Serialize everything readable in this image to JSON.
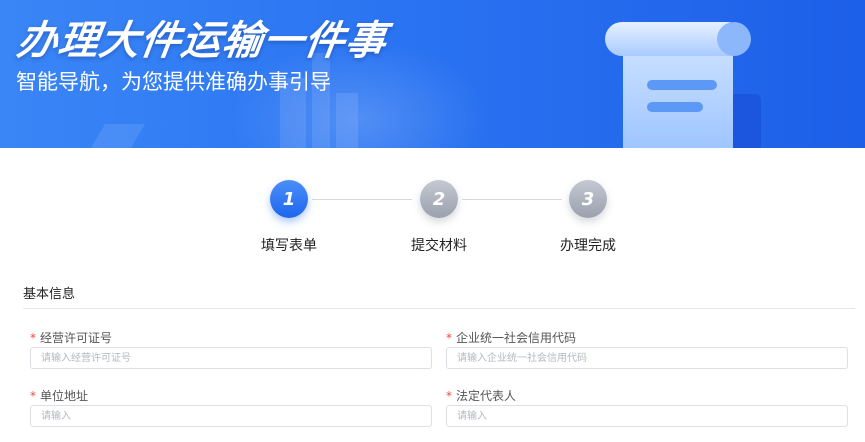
{
  "banner": {
    "title": "办理大件运输一件事",
    "subtitle": "智能导航，为您提供准确办事引导"
  },
  "steps": [
    {
      "number": "1",
      "label": "填写表单",
      "state": "active"
    },
    {
      "number": "2",
      "label": "提交材料",
      "state": "inactive"
    },
    {
      "number": "3",
      "label": "办理完成",
      "state": "inactive"
    }
  ],
  "form": {
    "section_title": "基本信息",
    "required_mark": "*",
    "fields": [
      {
        "label": "经营许可证号",
        "value": "",
        "placeholder": "请输入经营许可证号"
      },
      {
        "label": "企业统一社会信用代码",
        "value": "",
        "placeholder": "请输入企业统一社会信用代码"
      },
      {
        "label": "单位地址",
        "value": "",
        "placeholder": "请输入"
      },
      {
        "label": "法定代表人",
        "value": "",
        "placeholder": "请输入"
      }
    ]
  },
  "colors": {
    "primary": "#1d66ee",
    "required": "#f04a3a",
    "inactive_step": "#9aa1ad"
  }
}
